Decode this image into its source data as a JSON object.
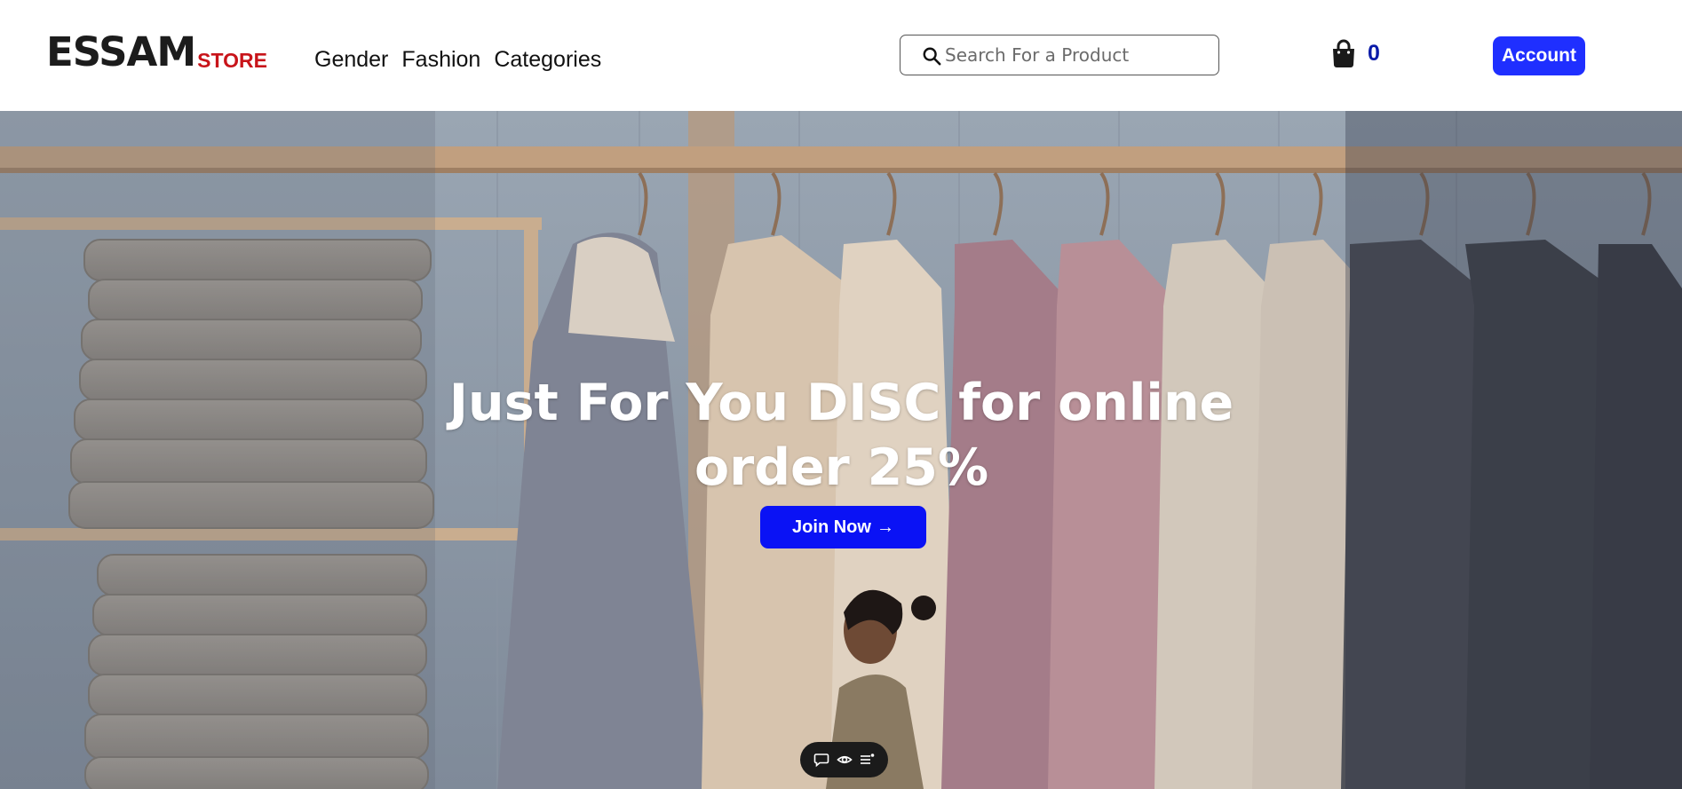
{
  "header": {
    "logo_main": "ESSAM",
    "logo_sub": "STORE",
    "nav": [
      {
        "label": "Gender"
      },
      {
        "label": "Fashion"
      },
      {
        "label": "Categories"
      }
    ],
    "search_placeholder": "Search For a Product",
    "cart_count": "0",
    "account_label": "Account"
  },
  "hero": {
    "title_line1": "Just For You DISC for online",
    "title_line2": "order 25%",
    "cta_label": "Join Now",
    "cta_arrow": "→"
  },
  "colors": {
    "logo_main": "#1c1c1c",
    "logo_sub": "#c8141a",
    "cart_count": "#0a1aa8",
    "account_button": "#1f2fff",
    "cta_button": "#0a12f5",
    "toolbar": "#1b1b1b"
  },
  "icons": {
    "search": "search-icon",
    "cart": "shopping-bag-icon",
    "toolbar": [
      "comment-icon",
      "eye-icon",
      "menu-list-icon"
    ]
  }
}
